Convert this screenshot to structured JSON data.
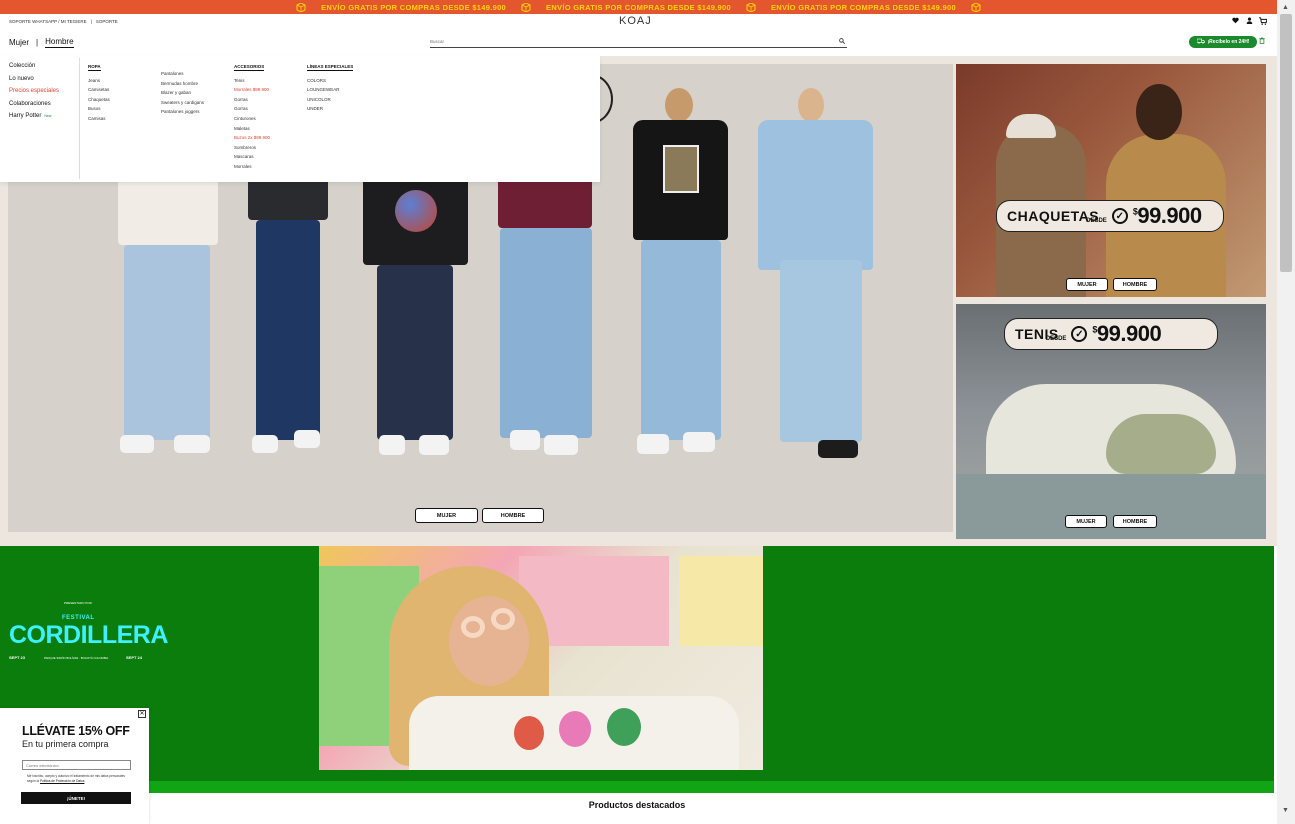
{
  "promo": {
    "items": [
      "ENVÍO GRATIS POR COMPRAS DESDE $149.900",
      "ENVÍO GRATIS POR COMPRAS DESDE $149.900",
      "ENVÍO GRATIS POR COMPRAS DESDE $149.900"
    ],
    "icon": "box-icon",
    "bg_color": "#e4572e",
    "text_color": "#ffd400"
  },
  "header": {
    "util_links": [
      "SOPORTE WHATSAPP / MI TEGIERE",
      "|",
      "SOPORTE"
    ],
    "logo": "KOAJ",
    "icons": [
      "heart-icon",
      "user-icon",
      "cart-icon"
    ],
    "gender_tabs": [
      "Mujer",
      "Hombre"
    ],
    "gender_separator": "|",
    "active_gender": "Hombre",
    "search_placeholder": "Buscar",
    "delivery_label": "¡Recíbelo en 24H!",
    "accent_color": "#1b8a2c"
  },
  "menu": {
    "side": [
      {
        "label": "Colección"
      },
      {
        "label": "Lo nuevo"
      },
      {
        "label": "Precios especiales",
        "highlight": true
      },
      {
        "label": "Colaboraciones"
      },
      {
        "label": "Harry Potter",
        "tag": "New"
      }
    ],
    "col_ropa": {
      "heading": "ROPA",
      "items": [
        "Jeans",
        "Camisetas",
        "Chaquetas",
        "Busos",
        "Camisas"
      ]
    },
    "col_ropa2": {
      "items": [
        "Pantalones",
        "Bermudas hombre",
        "Blazer y gaban",
        "Sweaters y cardigans",
        "Pantalones joggers"
      ]
    },
    "col_accesorios": {
      "heading": "ACCESORIOS",
      "items": [
        "Tenis",
        "Morrales $99.900",
        "Gorras",
        "Gorras",
        "Cinturones",
        "Maletas",
        "Buzos 2x $99.900",
        "Sombreros",
        "Mascaras",
        "Morrales"
      ]
    },
    "col_lineas": {
      "heading": "LÍNEAS ESPECIALES",
      "items": [
        "COLORS",
        "LOUNGEWEAR",
        "UNICOLOR",
        "UNDER"
      ]
    }
  },
  "hero": {
    "buttons": [
      "MUJER",
      "HOMBRE"
    ]
  },
  "banner_top": {
    "label": "CHAQUETAS",
    "desde": "DESDE",
    "price": "99.900",
    "currency": "$",
    "buttons": [
      "MUJER",
      "HOMBRE"
    ]
  },
  "banner_bottom": {
    "label": "TENIS",
    "desde": "DESDE",
    "price": "99.900",
    "currency": "$",
    "buttons": [
      "MUJER",
      "HOMBRE"
    ]
  },
  "festival": {
    "small": "PRESENTADO POR",
    "title_small": "FESTIVAL",
    "title": "CORDILLERA",
    "date_left": "SEPT 23",
    "date_right": "SEPT 24",
    "place": "PARQUE SIMÓN BOLÍVAR · BOGOTÁ COLOMBIA",
    "bg_color": "#0a7d0c"
  },
  "featured": {
    "title": "Productos destacados"
  },
  "popup": {
    "title": "LLÉVATE 15% OFF",
    "subtitle": "En tu primera compra",
    "email_placeholder": "Correo electrónico",
    "legal": "Me inscribo, acepto y autorizo el tratamiento de mis datos personales según la",
    "legal_link": "Política de Protección de Datos",
    "join_label": "¡ÚNETE!",
    "close": "✕"
  }
}
